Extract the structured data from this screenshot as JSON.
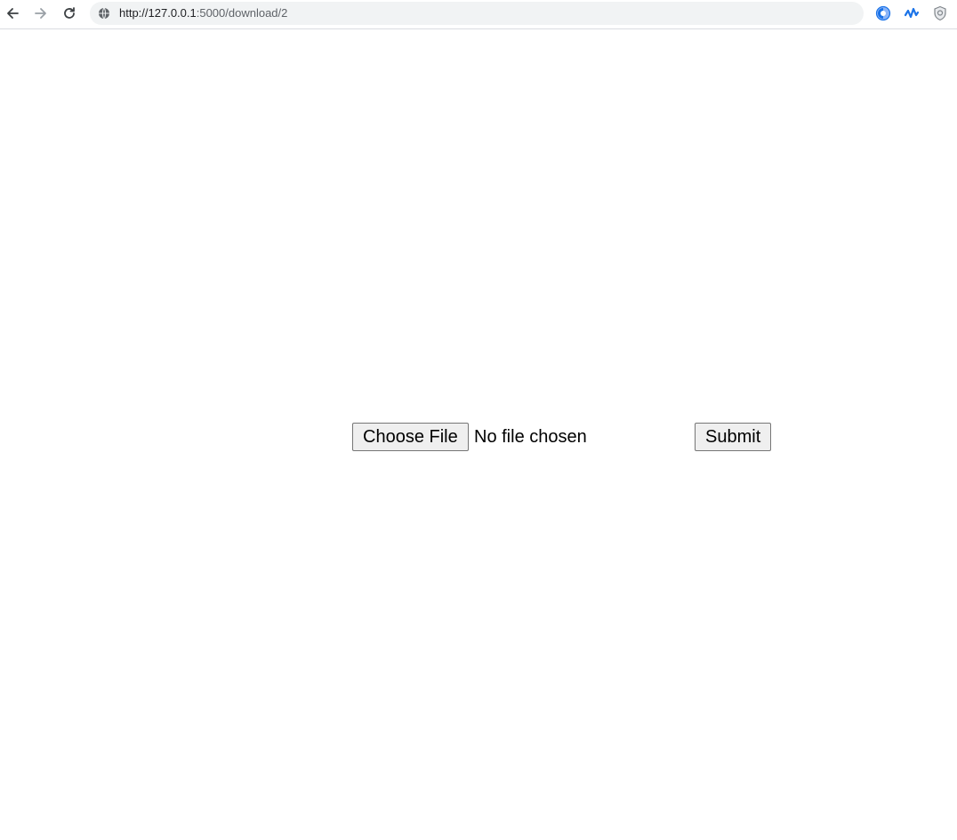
{
  "browser": {
    "url_host": "http://127.0.0.1",
    "url_rest": ":5000/download/2",
    "extensions": [
      "extension-1-icon",
      "extension-2-icon",
      "extension-3-icon"
    ]
  },
  "form": {
    "choose_file_label": "Choose File",
    "file_status": "No file chosen",
    "submit_label": "Submit"
  },
  "colors": {
    "omnibox_bg": "#f1f3f4",
    "button_bg": "#efefef",
    "button_border": "#767676",
    "ext_blue": "#1a73e8"
  }
}
